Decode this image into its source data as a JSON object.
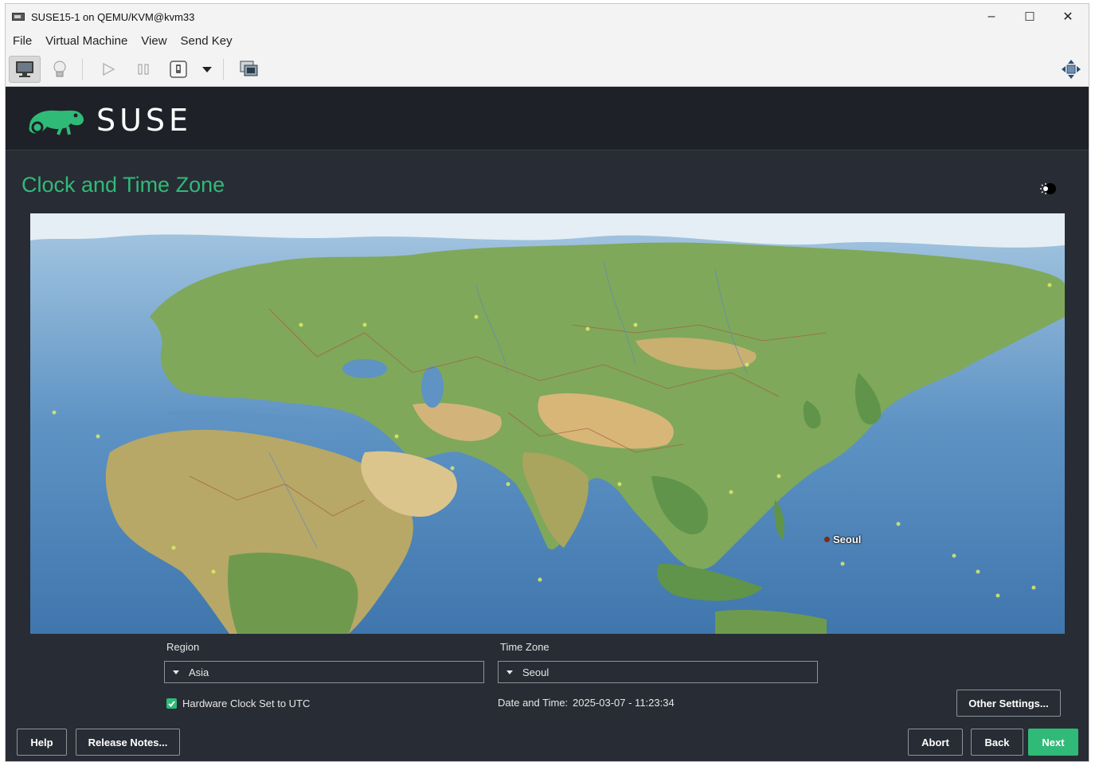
{
  "window": {
    "title": "SUSE15-1 on QEMU/KVM@kvm33",
    "controls": {
      "minimize": "–",
      "maximize": "☐",
      "close": "✕"
    }
  },
  "menu": {
    "items": [
      "File",
      "Virtual Machine",
      "View",
      "Send Key"
    ]
  },
  "toolbar": {
    "buttons": [
      "monitor-icon",
      "lightbulb-icon",
      "play-icon",
      "pause-icon",
      "power-icon",
      "dropdown-arrow-icon",
      "screenshot-icon",
      "resize-icon"
    ]
  },
  "installer": {
    "brand": "SUSE",
    "page_title": "Clock and Time Zone",
    "map": {
      "highlighted_city": "Seoul"
    },
    "region_label": "Region",
    "region_value": "Asia",
    "timezone_label": "Time Zone",
    "timezone_value": "Seoul",
    "hw_clock_label": "Hardware Clock Set to UTC",
    "hw_clock_checked": true,
    "date_time_label": "Date and Time:",
    "date_time_value": "2025-03-07 - 11:23:34",
    "buttons": {
      "other_settings": "Other Settings...",
      "help": "Help",
      "release_notes": "Release Notes...",
      "abort": "Abort",
      "back": "Back",
      "next": "Next"
    }
  },
  "colors": {
    "accent": "#30ba78",
    "background": "#282c34",
    "header": "#1e2127"
  }
}
